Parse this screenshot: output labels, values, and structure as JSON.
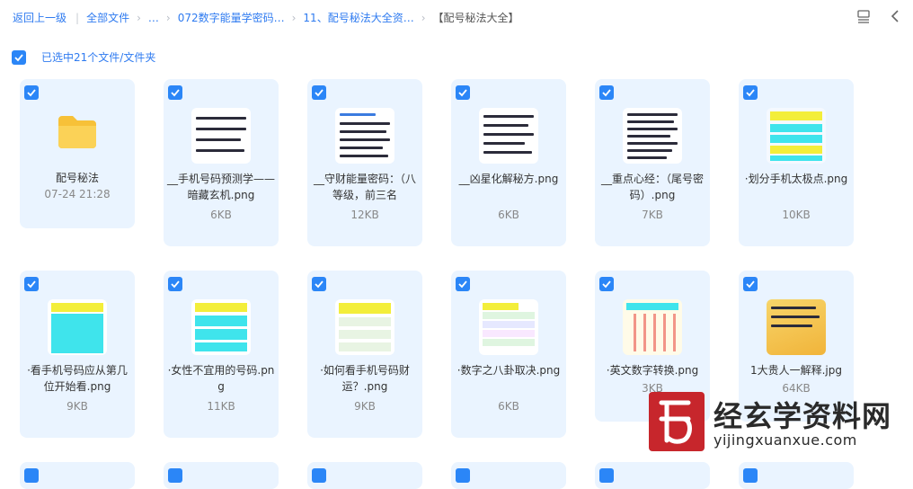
{
  "breadcrumb": {
    "back": "返回上一级",
    "all": "全部文件",
    "ellipsis": "…",
    "level1": "072数字能量学密码…",
    "level2": "11、配号秘法大全资…",
    "current": "【配号秘法大全】"
  },
  "selection": {
    "label": "已选中21个文件/文件夹"
  },
  "items": [
    {
      "name": "配号秘法",
      "meta": "07-24 21:28"
    },
    {
      "name": "__手机号码预测学——暗藏玄机.png",
      "meta": "6KB"
    },
    {
      "name": "__守财能量密码：（八等级，前三名",
      "meta": "12KB"
    },
    {
      "name": "__凶星化解秘方.png",
      "meta": "6KB"
    },
    {
      "name": "__重点心经：（尾号密码）.png",
      "meta": "7KB"
    },
    {
      "name": "·划分手机太极点.png",
      "meta": "10KB"
    },
    {
      "name": "·看手机号码应从第几位开始看.png",
      "meta": "9KB"
    },
    {
      "name": "·女性不宜用的号码.png",
      "meta": "11KB"
    },
    {
      "name": "·如何看手机号码财运？.png",
      "meta": "9KB"
    },
    {
      "name": "·数字之八卦取决.png",
      "meta": "6KB"
    },
    {
      "name": "·英文数字转换.png",
      "meta": "3KB"
    },
    {
      "name": "1大贵人一解释.jpg",
      "meta": "64KB"
    }
  ],
  "watermark": {
    "cn": "经玄学资料网",
    "en": "yijingxuanxue.com"
  },
  "colors": {
    "accent": "#2b86f7",
    "card": "#eaf4ff",
    "link": "#2f7bf0",
    "brand": "#c7262c"
  }
}
